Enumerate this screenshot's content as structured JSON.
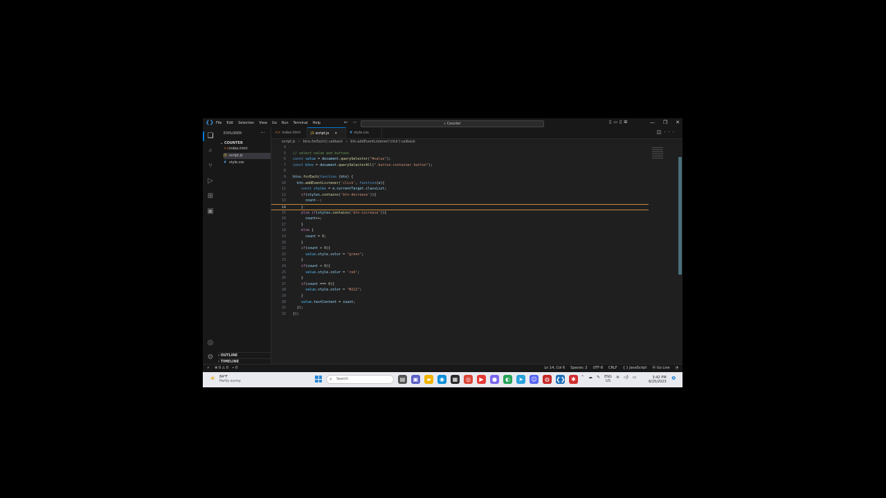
{
  "titlebar": {
    "menu": [
      "File",
      "Edit",
      "Selection",
      "View",
      "Go",
      "Run",
      "Terminal",
      "Help"
    ],
    "search": "Counter"
  },
  "sidebar": {
    "title": "EXPLORER",
    "folder": "COUNTER",
    "files": [
      {
        "name": "index.html",
        "type": "html"
      },
      {
        "name": "script.js",
        "type": "js"
      },
      {
        "name": "style.css",
        "type": "css"
      }
    ],
    "outline": "OUTLINE",
    "timeline": "TIMELINE"
  },
  "tabs": [
    {
      "label": "index.html",
      "type": "html"
    },
    {
      "label": "script.js",
      "type": "js",
      "active": true
    },
    {
      "label": "style.css",
      "type": "css"
    }
  ],
  "breadcrumb": [
    "script.js",
    "btns.forEach() callback",
    "btn.addEventListener('click') callback"
  ],
  "editor": {
    "current_line": 14,
    "lines": [
      {
        "n": "4",
        "html": ""
      },
      {
        "n": "5",
        "html": "<span class=\"cm\">// select value and buttons</span>"
      },
      {
        "n": "6",
        "html": "<span class=\"kw\">const</span> <span class=\"cls\">value</span> = <span class=\"var\">document</span>.<span class=\"fn\">querySelector</span>(<span class=\"str\">\"#value\"</span>);"
      },
      {
        "n": "7",
        "html": "<span class=\"kw\">const</span> <span class=\"cls\">btns</span> = <span class=\"var\">document</span>.<span class=\"fn\">querySelectorAll</span>(<span class=\"str\">\".button-container button\"</span>);"
      },
      {
        "n": "8",
        "html": ""
      },
      {
        "n": "9",
        "html": "<span class=\"var\">btns</span>.<span class=\"fn\">forEach</span>(<span class=\"kw\">function</span> (<span class=\"var\">btn</span>) {"
      },
      {
        "n": "10",
        "html": "  <span class=\"var\">btn</span>.<span class=\"fn\">addEventListener</span>(<span class=\"str\">'click'</span>, <span class=\"kw\">function</span>(<span class=\"var\">e</span>){"
      },
      {
        "n": "11",
        "html": "    <span class=\"kw\">const</span> <span class=\"cls\">styles</span> = <span class=\"var\">e</span>.<span class=\"var\">currentTarget</span>.<span class=\"var\">classList</span>;"
      },
      {
        "n": "12",
        "html": "    <span class=\"cf\">if</span>(<span class=\"var\">styles</span>.<span class=\"fn\">contains</span>(<span class=\"str\">'btn-decrease'</span>)){"
      },
      {
        "n": "13",
        "html": "      <span class=\"var\">count</span>--;"
      },
      {
        "n": "14",
        "html": "    }"
      },
      {
        "n": "15",
        "html": "    <span class=\"cf\">else if</span>(<span class=\"var\">styles</span>.<span class=\"fn\">contains</span>(<span class=\"str\">'btn-increase'</span>)){"
      },
      {
        "n": "16",
        "html": "      <span class=\"var\">count</span>++;"
      },
      {
        "n": "17",
        "html": "    }"
      },
      {
        "n": "18",
        "html": "    <span class=\"cf\">else</span> {"
      },
      {
        "n": "19",
        "html": "      <span class=\"var\">count</span> = <span class=\"num\">0</span>;"
      },
      {
        "n": "20",
        "html": "    }"
      },
      {
        "n": "21",
        "html": "    <span class=\"cf\">if</span>(<span class=\"var\">count</span> &gt; <span class=\"num\">0</span>){"
      },
      {
        "n": "22",
        "html": "      <span class=\"cls\">value</span>.<span class=\"var\">style</span>.<span class=\"var\">color</span> = <span class=\"str\">\"green\"</span>;"
      },
      {
        "n": "23",
        "html": "    }"
      },
      {
        "n": "24",
        "html": "    <span class=\"cf\">if</span>(<span class=\"var\">count</span> &lt; <span class=\"num\">0</span>){"
      },
      {
        "n": "25",
        "html": "      <span class=\"cls\">value</span>.<span class=\"var\">style</span>.<span class=\"var\">color</span> = <span class=\"str\">'red'</span>;"
      },
      {
        "n": "26",
        "html": "    }"
      },
      {
        "n": "27",
        "html": "    <span class=\"cf\">if</span>(<span class=\"var\">count</span> === <span class=\"num\">0</span>){"
      },
      {
        "n": "28",
        "html": "      <span class=\"cls\">value</span>.<span class=\"var\">style</span>.<span class=\"var\">color</span> = <span class=\"str\">\"#222\"</span>;"
      },
      {
        "n": "29",
        "html": "    }"
      },
      {
        "n": "30",
        "html": "    <span class=\"cls\">value</span>.<span class=\"var\">textContent</span> = <span class=\"var\">count</span>;"
      },
      {
        "n": "31",
        "html": "  });"
      },
      {
        "n": "32",
        "html": "});"
      }
    ]
  },
  "statusbar": {
    "problems": "⊗ 0 ⚠ 0",
    "ports": "⌁ 0",
    "position": "Ln 14, Col 6",
    "spaces": "Spaces: 2",
    "encoding": "UTF-8",
    "eol": "CRLF",
    "language": "{ } JavaScript",
    "golive": "⦿ Go Live"
  },
  "taskbar": {
    "temp": "84°F",
    "condition": "Partly sunny",
    "search": "Search",
    "lang1": "ENG",
    "lang2": "US",
    "time": "3:42 PM",
    "date": "8/25/2023"
  },
  "colors": {
    "accent": "#0078d4",
    "editor_bg": "#1f1f1f",
    "current_line_border": "#c48b3a"
  }
}
